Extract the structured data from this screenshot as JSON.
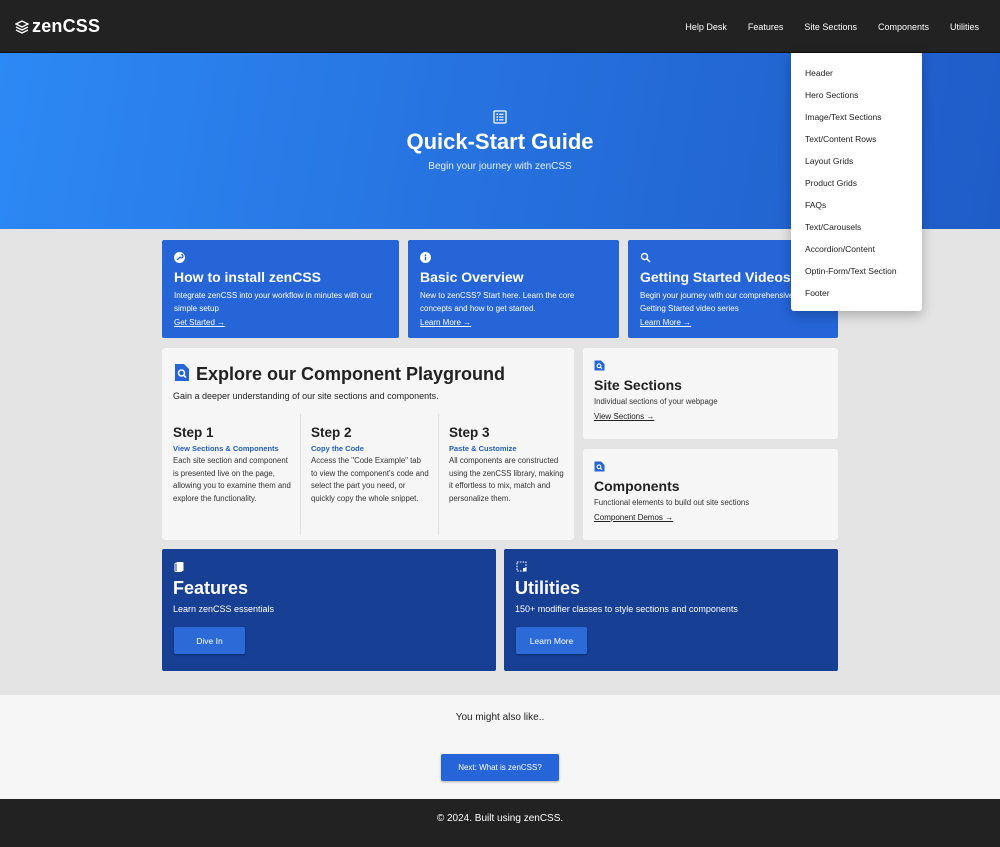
{
  "brand": {
    "name": "zenCSS",
    "icon": "stack-logo-icon"
  },
  "nav": {
    "items": [
      "Help Desk",
      "Features",
      "Site Sections",
      "Components",
      "Utilities"
    ]
  },
  "dropdown": {
    "items": [
      "Header",
      "Hero Sections",
      "Image/Text Sections",
      "Text/Content Rows",
      "Layout Grids",
      "Product Grids",
      "FAQs",
      "Text/Carousels",
      "Accordion/Content",
      "Optin-Form/Text Section",
      "Footer"
    ]
  },
  "hero": {
    "icon": "list-document-icon",
    "title": "Quick-Start Guide",
    "subtitle": "Begin your journey with zenCSS"
  },
  "top_cards": [
    {
      "icon": "wrench-icon",
      "title": "How to install zenCSS",
      "text": "Integrate zenCSS into your workflow in minutes with our simple setup",
      "link": "Get Started →"
    },
    {
      "icon": "info-icon",
      "title": "Basic Overview",
      "text": "New to zenCSS? Start here. Learn the core concepts and how to get started.",
      "link": "Learn More →"
    },
    {
      "icon": "search-icon",
      "title": "Getting Started Videos",
      "text": "Begin your journey with our comprehensive Getting Started video series",
      "link": "Learn More →"
    }
  ],
  "playground": {
    "icon": "search-document-icon",
    "title": "Explore our Component Playground",
    "subtitle": "Gain a deeper understanding of our site sections and components.",
    "steps": [
      {
        "title": "Step 1",
        "subtitle": "View Sections & Components",
        "text": "Each site section and component is presented live on the page, allowing you to examine them and explore the functionality."
      },
      {
        "title": "Step 2",
        "subtitle": "Copy the Code",
        "text": "Access the \"Code Example\" tab to view the component's code and select the part you need, or quickly copy the whole snippet."
      },
      {
        "title": "Step 3",
        "subtitle": "Paste & Customize",
        "text": "All components are constructed using the zenCSS library, making it effortless to mix, match and personalize them."
      }
    ]
  },
  "side_cards": [
    {
      "icon": "search-document-icon",
      "title": "Site Sections",
      "text": "Individual sections of your webpage",
      "link": "View Sections →"
    },
    {
      "icon": "search-document-icon",
      "title": "Components",
      "text": "Functional elements to build out site sections",
      "link": "Component Demos →"
    }
  ],
  "bottom_cards": [
    {
      "icon": "book-icon",
      "title": "Features",
      "text": "Learn zenCSS essentials",
      "button": "Dive In"
    },
    {
      "icon": "selection-icon",
      "title": "Utilities",
      "text": "150+ modifier classes to style sections and components",
      "button": "Learn More"
    }
  ],
  "also": {
    "text": "You might also like..",
    "button": "Next: What is zenCSS?"
  },
  "footer": {
    "text": "© 2024. Built using zenCSS."
  },
  "colors": {
    "nav_bg": "#222222",
    "hero_blue": "#2d89f5",
    "card_blue": "#2565d8",
    "card_navy": "#173f94",
    "accent_text": "#2260c4"
  }
}
